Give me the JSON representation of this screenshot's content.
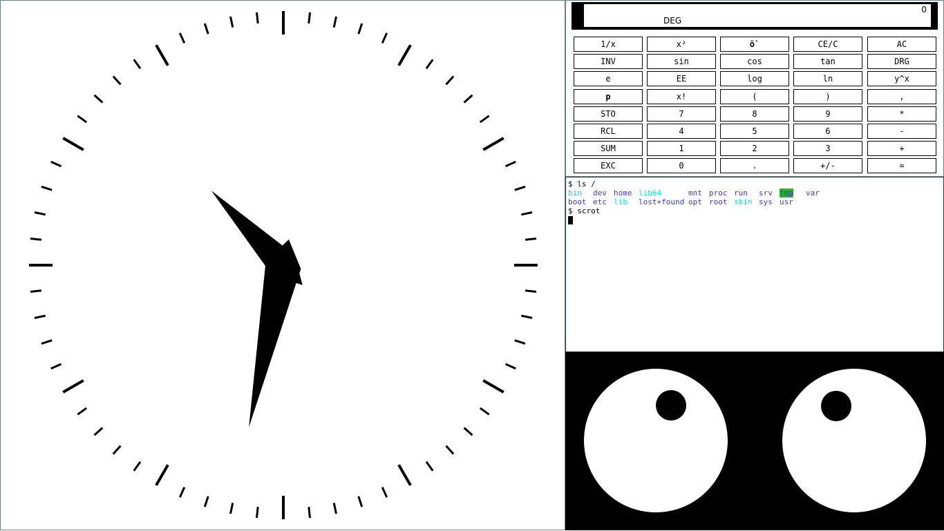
{
  "clock": {
    "hour": 10,
    "minute": 32,
    "tick_color": "#000000",
    "hand_color": "#000000"
  },
  "calculator": {
    "display_value": "0",
    "angle_mode": "DEG",
    "keys": [
      "1/x",
      "x²",
      "ö`",
      "CE/C",
      "AC",
      "INV",
      "sin",
      "cos",
      "tan",
      "DRG",
      "e",
      "EE",
      "log",
      "ln",
      "y^x",
      "p",
      "x!",
      "(",
      ")",
      ",",
      "STO",
      "7",
      "8",
      "9",
      "*",
      "RCL",
      "4",
      "5",
      "6",
      "-",
      "SUM",
      "1",
      "2",
      "3",
      "+",
      "EXC",
      "0",
      ".",
      "+/-",
      "="
    ]
  },
  "terminal": {
    "prompt1": "$ ls /",
    "prompt2": "$ scrot",
    "ls_row1": [
      {
        "name": "bin",
        "color": "#2fb8ff"
      },
      {
        "name": "dev",
        "color": "#3b3bd0"
      },
      {
        "name": "home",
        "color": "#3b3bd0"
      },
      {
        "name": "lib64",
        "color": "#00e5e5"
      },
      {
        "name": "mnt",
        "color": "#3b3bd0"
      },
      {
        "name": "proc",
        "color": "#3b3bd0"
      },
      {
        "name": "run",
        "color": "#3b3bd0"
      },
      {
        "name": "srv",
        "color": "#3b3bd0"
      },
      {
        "name": "tmp",
        "color": "#3b3bd0",
        "highlight": "#22b822"
      },
      {
        "name": "var",
        "color": "#3b3bd0"
      }
    ],
    "ls_row2": [
      {
        "name": "boot",
        "color": "#3b3bd0"
      },
      {
        "name": "etc",
        "color": "#3b3bd0"
      },
      {
        "name": "lib",
        "color": "#00e5e5"
      },
      {
        "name": "lost+found",
        "color": "#3b3bd0"
      },
      {
        "name": "opt",
        "color": "#3b3bd0"
      },
      {
        "name": "root",
        "color": "#3b3bd0"
      },
      {
        "name": "sbin",
        "color": "#00e5e5"
      },
      {
        "name": "sys",
        "color": "#3b3bd0"
      },
      {
        "name": "usr",
        "color": "#3b3bd0"
      }
    ]
  },
  "eyes": {
    "background": "#000000",
    "sclera_color": "#ffffff",
    "pupil_color": "#000000"
  }
}
